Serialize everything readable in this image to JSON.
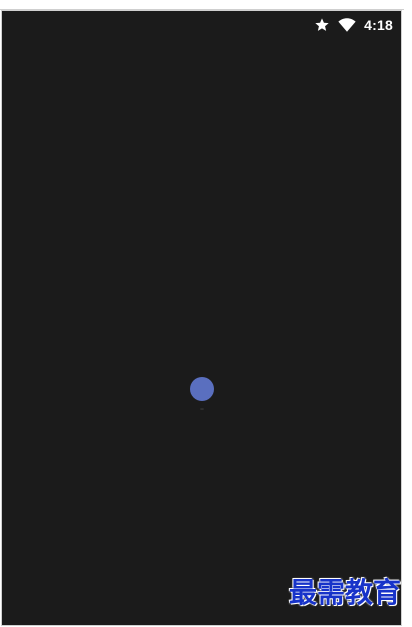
{
  "status_bar": {
    "time": "4:18",
    "icons": [
      "star-icon",
      "wifi-icon"
    ]
  },
  "loading": {
    "indicator_color": "#5a6fbf"
  },
  "watermark": {
    "text": "最需教育"
  },
  "colors": {
    "screen_background": "#1b1b1b",
    "status_text": "#ffffff",
    "watermark": "#1733c9"
  }
}
